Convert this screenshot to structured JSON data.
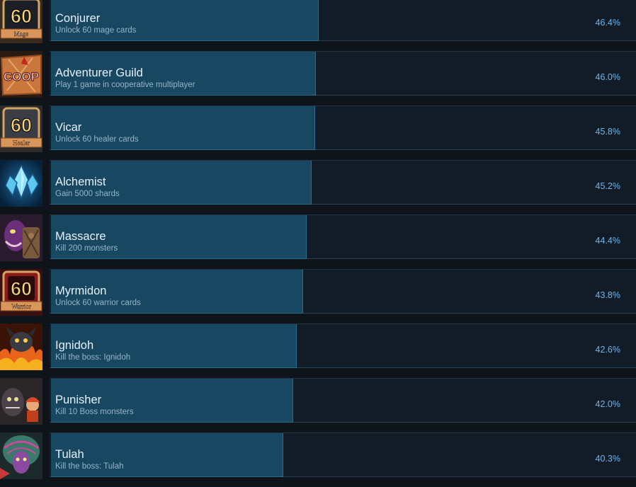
{
  "achievements": [
    {
      "title": "Conjurer",
      "description": "Unlock 60 mage cards",
      "percent_text": "46.4%",
      "percent": 46.4,
      "icon": "sixty-mage-icon",
      "icon_number": "60",
      "icon_caption": "Mage"
    },
    {
      "title": "Adventurer Guild",
      "description": "Play 1 game in cooperative multiplayer",
      "percent_text": "46.0%",
      "percent": 46.0,
      "icon": "coop-map-icon",
      "icon_text": "COOP"
    },
    {
      "title": "Vicar",
      "description": "Unlock 60 healer cards",
      "percent_text": "45.8%",
      "percent": 45.8,
      "icon": "sixty-healer-icon",
      "icon_number": "60",
      "icon_caption": "Healer"
    },
    {
      "title": "Alchemist",
      "description": "Gain 5000 shards",
      "percent_text": "45.2%",
      "percent": 45.2,
      "icon": "crystal-shards-icon"
    },
    {
      "title": "Massacre",
      "description": "Kill 200 monsters",
      "percent_text": "44.4%",
      "percent": 44.4,
      "icon": "purple-monster-icon"
    },
    {
      "title": "Myrmidon",
      "description": "Unlock 60 warrior cards",
      "percent_text": "43.8%",
      "percent": 43.8,
      "icon": "sixty-warrior-icon",
      "icon_number": "60",
      "icon_caption": "Warrior"
    },
    {
      "title": "Ignidoh",
      "description": "Kill the boss: Ignidoh",
      "percent_text": "42.6%",
      "percent": 42.6,
      "icon": "fire-demon-icon"
    },
    {
      "title": "Punisher",
      "description": "Kill 10 Boss monsters",
      "percent_text": "42.0%",
      "percent": 42.0,
      "icon": "boss-group-icon"
    },
    {
      "title": "Tulah",
      "description": "Kill the boss: Tulah",
      "percent_text": "40.3%",
      "percent": 40.3,
      "icon": "tulah-boss-icon"
    }
  ],
  "colors": {
    "page_background": "#0f141b",
    "row_background": "#121c26",
    "progress_fill": "#184761",
    "title_text": "#e6f1f8",
    "description_text": "#95b4c6",
    "percent_text": "#6fb5f0",
    "mage_badge": "#1c1f28",
    "healer_badge": "#3a3d44",
    "warrior_badge": "#8e1b1b",
    "badge_number": "#f5d27a",
    "badge_ribbon": "#d9955a"
  }
}
